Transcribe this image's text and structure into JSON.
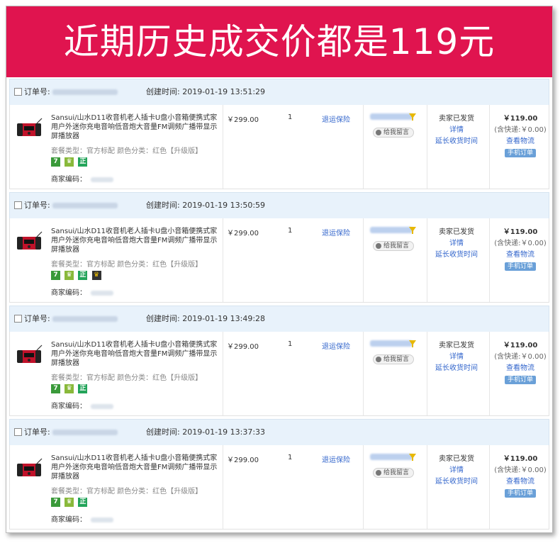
{
  "banner": {
    "text": "近期历史成交价都是119元"
  },
  "labels": {
    "order_no": "订单号:",
    "created_prefix": "创建时间:",
    "spec": "套餐类型：官方标配   颜色分类：红色【升级版】",
    "merchant": "商家编码：",
    "protection": "退运保险",
    "message": "给我留言",
    "status": "卖家已发货",
    "details": "详情",
    "extend": "延长收货时间",
    "shipping": "(含快递:￥0.00)",
    "logistics": "查看物流",
    "mobile_order": "手机订单"
  },
  "product": {
    "title": "Sansui/山水D11收音机老人插卡U盘小音箱便携式家用户外迷你充电音响低音炮大音量FM调频广播带显示屏播放器",
    "price": "￥299.00",
    "quantity": "1",
    "total": "￥119.00"
  },
  "badge_text": {
    "seven": "7",
    "shield": "♛",
    "zheng": "正",
    "crown": "♛"
  },
  "orders": [
    {
      "created": "创建时间: 2019-01-19 13:51:29",
      "has_crown_badge": false,
      "has_protection": true
    },
    {
      "created": "创建时间: 2019-01-19 13:50:59",
      "has_crown_badge": true,
      "has_protection": true
    },
    {
      "created": "创建时间: 2019-01-19 13:49:28",
      "has_crown_badge": false,
      "has_protection": true
    },
    {
      "created": "创建时间: 2019-01-19 13:37:33",
      "has_crown_badge": false,
      "has_protection": true
    }
  ],
  "colors": {
    "banner": "#e0144f",
    "header_bg": "#e8f2fb",
    "link": "#3366cc",
    "mobile_button": "#6aa0d8"
  }
}
